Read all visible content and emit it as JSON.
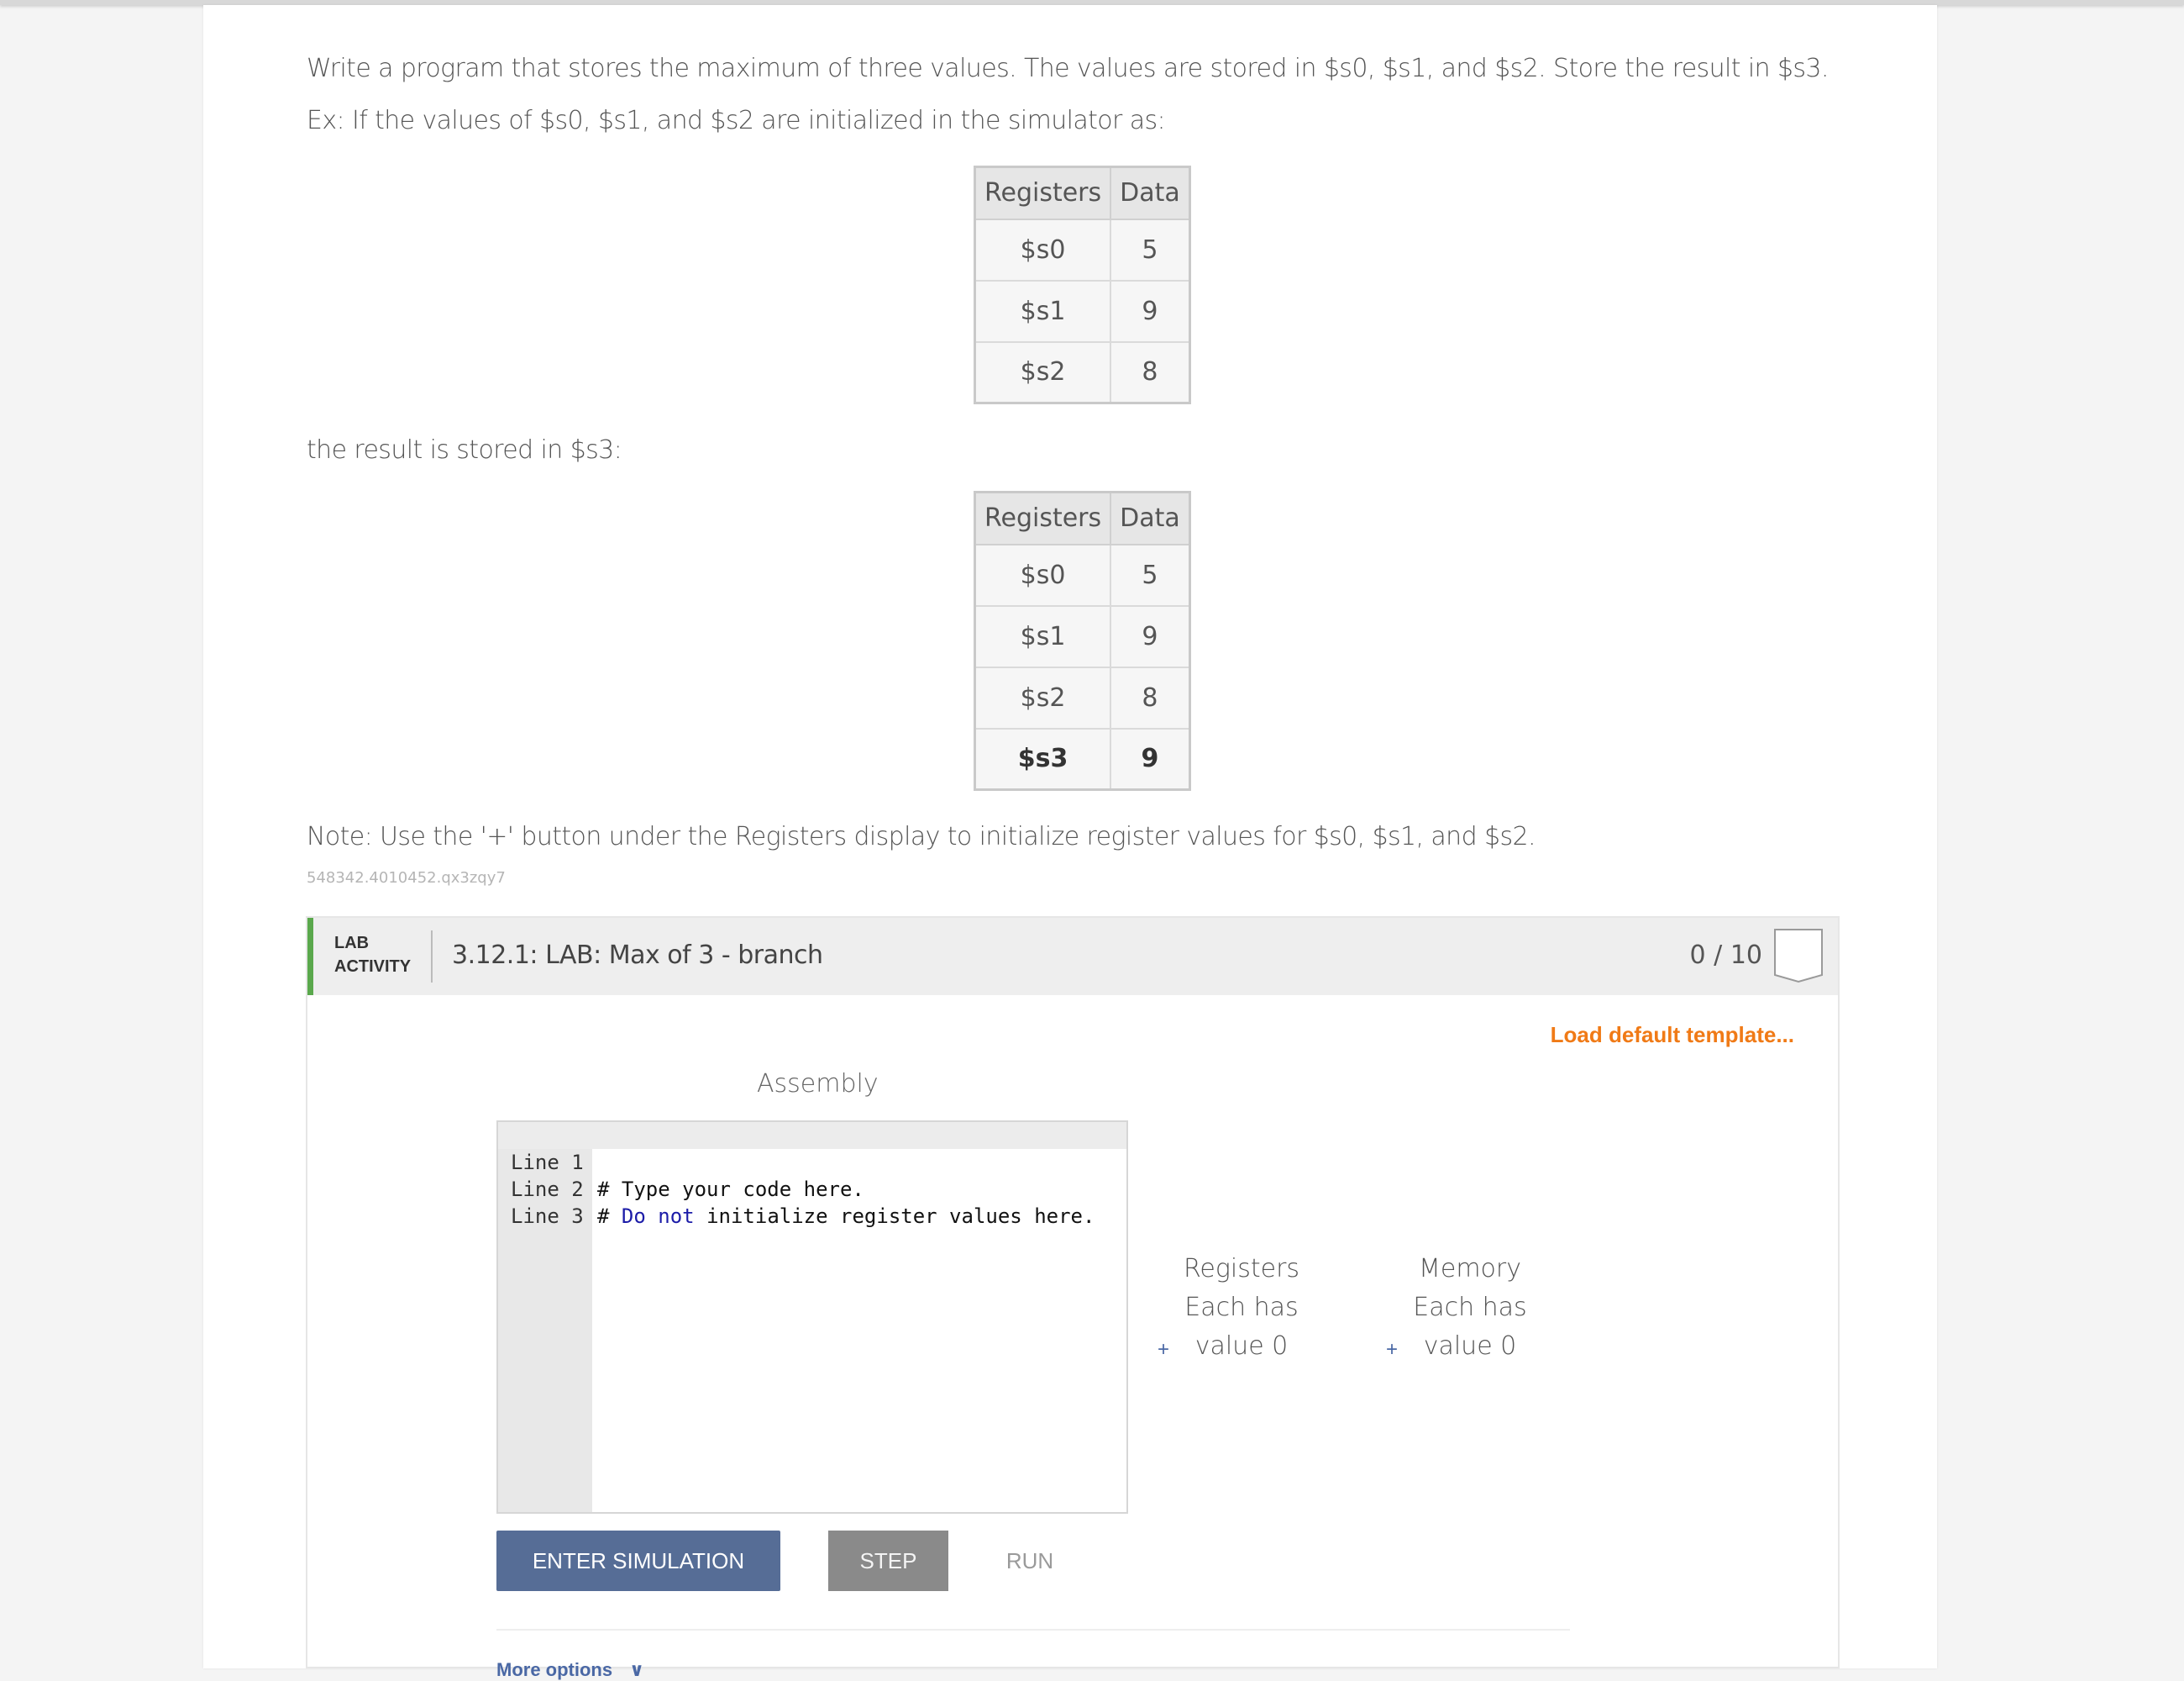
{
  "prompt": {
    "line1": "Write a program that stores the maximum of three values. The values are stored in $s0, $s1, and $s2. Store the result in $s3.",
    "line2": "Ex: If the values of $s0, $s1, and $s2 are initialized in the simulator as:",
    "result_text": "the result is stored in $s3:",
    "note": "Note: Use the '+' button under the Registers display to initialize register values for $s0, $s1, and $s2.",
    "id": "548342.4010452.qx3zqy7"
  },
  "table1": {
    "headers": [
      "Registers",
      "Data"
    ],
    "rows": [
      {
        "reg": "$s0",
        "val": "5"
      },
      {
        "reg": "$s1",
        "val": "9"
      },
      {
        "reg": "$s2",
        "val": "8"
      }
    ]
  },
  "table2": {
    "headers": [
      "Registers",
      "Data"
    ],
    "rows": [
      {
        "reg": "$s0",
        "val": "5"
      },
      {
        "reg": "$s1",
        "val": "9"
      },
      {
        "reg": "$s2",
        "val": "8"
      },
      {
        "reg": "$s3",
        "val": "9"
      }
    ]
  },
  "lab": {
    "tag_line1": "LAB",
    "tag_line2": "ACTIVITY",
    "title": "3.12.1: LAB: Max of 3 - branch",
    "score": "0 / 10",
    "load_template": "Load default template...",
    "editor_label": "Assembly",
    "lines": [
      {
        "num": "Line 1",
        "code": "# Type your code here."
      },
      {
        "num": "Line 2",
        "code_a": "# ",
        "kw1": "Do",
        "sp": " ",
        "kw2": "not",
        "code_b": " initialize register values here."
      },
      {
        "num": "Line 3",
        "code": ""
      }
    ],
    "registers_title": "Registers",
    "registers_sub": "Each has value 0",
    "memory_title": "Memory",
    "memory_sub": "Each has value 0",
    "plus": "+",
    "buttons": {
      "enter": "ENTER SIMULATION",
      "step": "STEP",
      "run": "RUN"
    },
    "more_options": "More options",
    "chevron": "∨"
  },
  "colors": {
    "accent_green": "#5aa84c",
    "load_orange": "#f07a16",
    "button_blue": "#566d96",
    "link_blue": "#4a68a5"
  }
}
